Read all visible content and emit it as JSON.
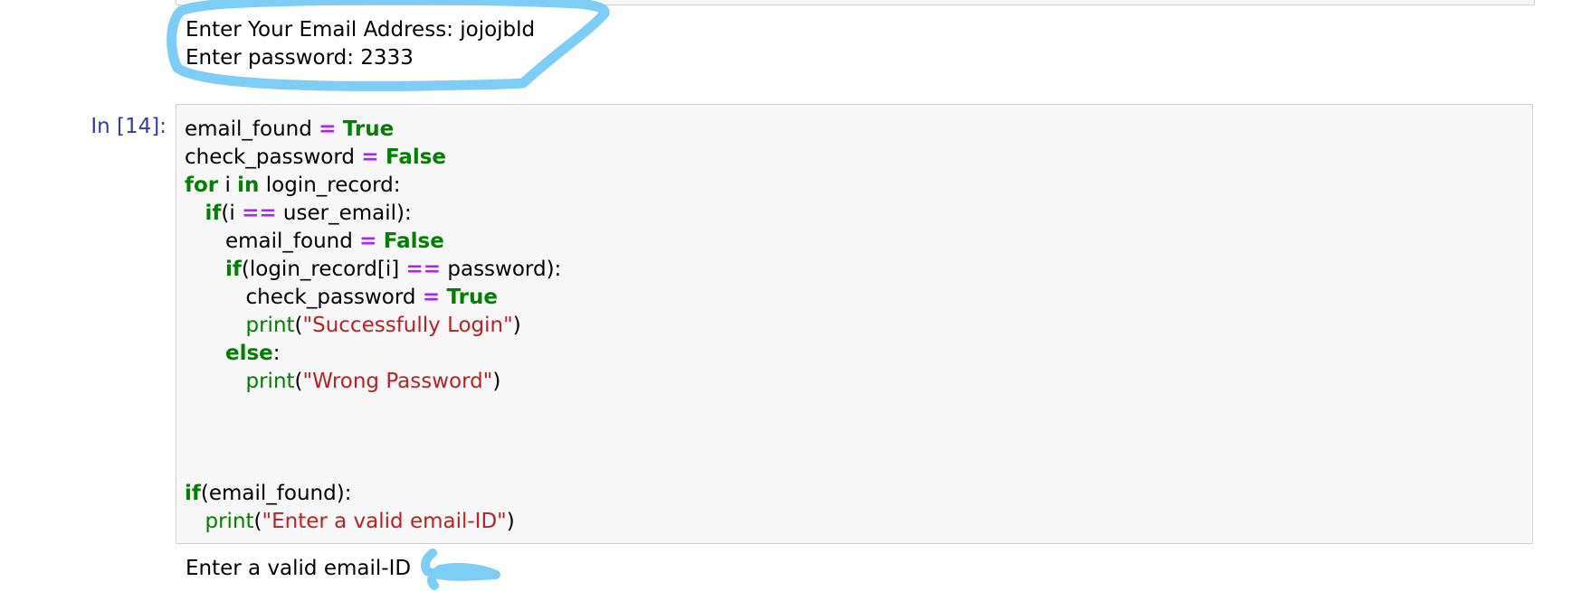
{
  "previous_output": {
    "email_prompt": "Enter Your Email Address: jojojbld",
    "password_prompt": "Enter password: 2333"
  },
  "cell": {
    "prompt": "In [14]:",
    "lines": [
      [
        {
          "t": "email_found",
          "c": "nm"
        },
        {
          "t": " ",
          "c": "nm"
        },
        {
          "t": "=",
          "c": "op"
        },
        {
          "t": " ",
          "c": "nm"
        },
        {
          "t": "True",
          "c": "kw"
        }
      ],
      [
        {
          "t": "check_password",
          "c": "nm"
        },
        {
          "t": " ",
          "c": "nm"
        },
        {
          "t": "=",
          "c": "op"
        },
        {
          "t": " ",
          "c": "nm"
        },
        {
          "t": "False",
          "c": "kw"
        }
      ],
      [
        {
          "t": "for",
          "c": "kw"
        },
        {
          "t": " i ",
          "c": "nm"
        },
        {
          "t": "in",
          "c": "kw"
        },
        {
          "t": " login_record:",
          "c": "nm"
        }
      ],
      [
        {
          "t": "if",
          "c": "kw"
        },
        {
          "t": "(i ",
          "c": "nm"
        },
        {
          "t": "==",
          "c": "op"
        },
        {
          "t": " user_email):",
          "c": "nm"
        }
      ],
      [
        {
          "t": "email_found",
          "c": "nm"
        },
        {
          "t": " ",
          "c": "nm"
        },
        {
          "t": "=",
          "c": "op"
        },
        {
          "t": " ",
          "c": "nm"
        },
        {
          "t": "False",
          "c": "kw"
        }
      ],
      [
        {
          "t": "if",
          "c": "kw"
        },
        {
          "t": "(login_record[i] ",
          "c": "nm"
        },
        {
          "t": "==",
          "c": "op"
        },
        {
          "t": " password):",
          "c": "nm"
        }
      ],
      [
        {
          "t": "check_password",
          "c": "nm"
        },
        {
          "t": " ",
          "c": "nm"
        },
        {
          "t": "=",
          "c": "op"
        },
        {
          "t": " ",
          "c": "nm"
        },
        {
          "t": "True",
          "c": "kw"
        }
      ],
      [
        {
          "t": "print",
          "c": "bi"
        },
        {
          "t": "(",
          "c": "nm"
        },
        {
          "t": "\"Successfully Login\"",
          "c": "st"
        },
        {
          "t": ")",
          "c": "nm"
        }
      ],
      [
        {
          "t": "else",
          "c": "kw"
        },
        {
          "t": ":",
          "c": "nm"
        }
      ],
      [
        {
          "t": "print",
          "c": "bi"
        },
        {
          "t": "(",
          "c": "nm"
        },
        {
          "t": "\"Wrong Password\"",
          "c": "st"
        },
        {
          "t": ")",
          "c": "nm"
        }
      ],
      [],
      [],
      [],
      [
        {
          "t": "if",
          "c": "kw"
        },
        {
          "t": "(email_found):",
          "c": "nm"
        }
      ],
      [
        {
          "t": "print",
          "c": "bi"
        },
        {
          "t": "(",
          "c": "nm"
        },
        {
          "t": "\"Enter a valid email-ID\"",
          "c": "st"
        },
        {
          "t": ")",
          "c": "nm"
        }
      ]
    ]
  },
  "output": {
    "text": "Enter a valid email-ID"
  },
  "colors": {
    "keyword": "#008000",
    "operator": "#aa22ff",
    "string": "#ba2121",
    "prompt": "#303f9f",
    "annotation": "#7ccef7",
    "cell_background": "#f7f7f7",
    "cell_border": "#cfcfcf"
  }
}
